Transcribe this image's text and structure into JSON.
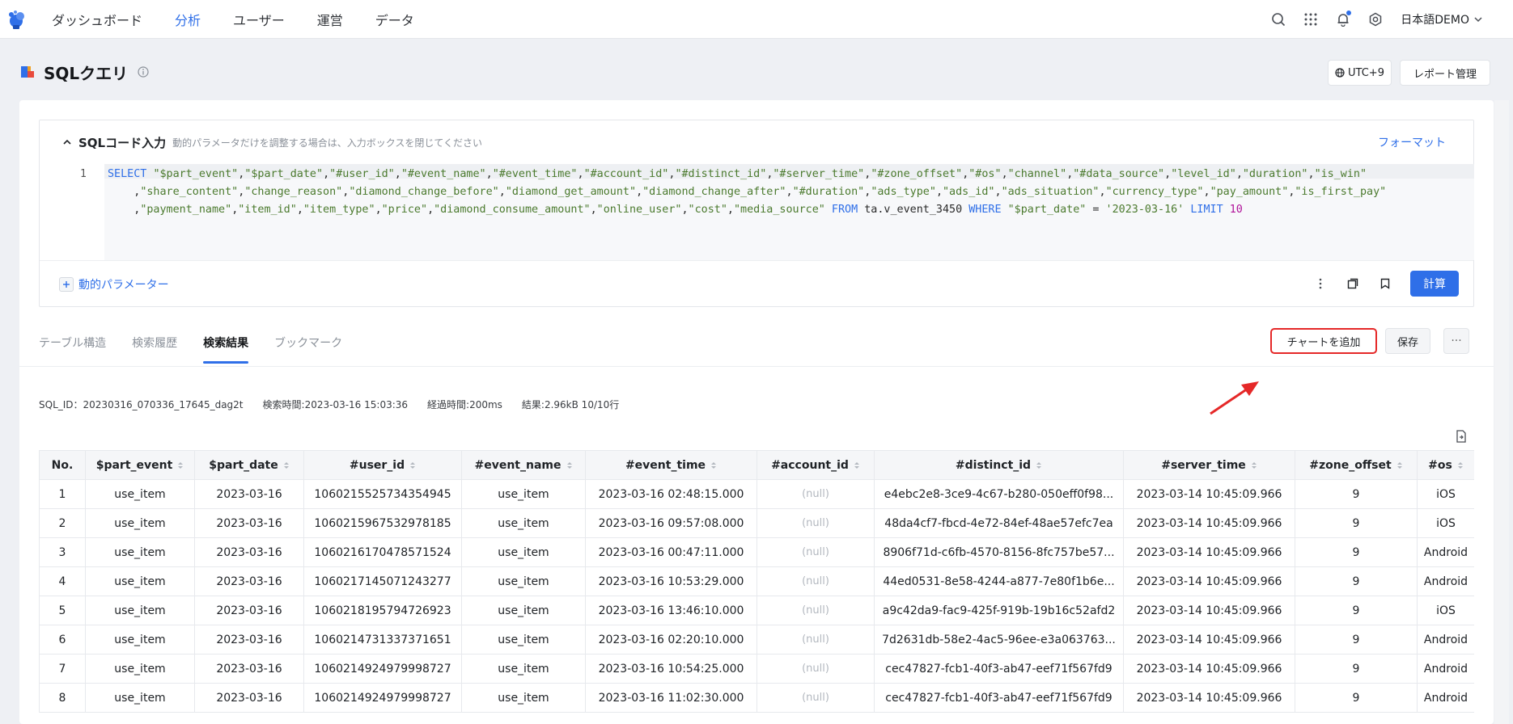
{
  "nav": {
    "items": [
      "ダッシュボード",
      "分析",
      "ユーザー",
      "運営",
      "データ"
    ],
    "active_index": 1,
    "user": "日本語DEMO",
    "icons": [
      "search-icon",
      "apps-grid-icon",
      "bell-icon",
      "gear-icon"
    ],
    "accent_color": "#2f6fe8"
  },
  "page": {
    "title": "SQLクエリ",
    "utc_label": "UTC+9",
    "report_label": "レポート管理"
  },
  "sql": {
    "title": "SQLコード入力",
    "hint": "動的パラメータだけを調整する場合は、入力ボックスを閉じてください",
    "format_label": "フォーマット",
    "line_number": "1",
    "code_lines": [
      "SELECT \"$part_event\",\"$part_date\",\"#user_id\",\"#event_name\",\"#event_time\",\"#account_id\",\"#distinct_id\",\"#server_time\",\"#zone_offset\",\"#os\",\"channel\",\"#data_source\",\"level_id\",\"duration\",\"is_win\"",
      "    ,\"share_content\",\"change_reason\",\"diamond_change_before\",\"diamond_get_amount\",\"diamond_change_after\",\"#duration\",\"ads_type\",\"ads_id\",\"ads_situation\",\"currency_type\",\"pay_amount\",\"is_first_pay\"",
      "    ,\"payment_name\",\"item_id\",\"item_type\",\"price\",\"diamond_consume_amount\",\"online_user\",\"cost\",\"media_source\" FROM ta.v_event_3450 WHERE \"$part_date\" = '2023-03-16' LIMIT 10"
    ],
    "dynamic_param_label": "動的パラメーター",
    "calc_label": "計算"
  },
  "tabs": [
    "テーブル構造",
    "検索履歴",
    "検索結果",
    "ブックマーク"
  ],
  "active_tab": 2,
  "actions": {
    "add_chart": "チャートを追加",
    "save": "保存",
    "more": "···"
  },
  "meta": {
    "sql_id": "SQL_ID：20230316_070336_17645_dag2t",
    "search_time": "検索時間:2023-03-16 15:03:36",
    "elapsed": "経過時間:200ms",
    "result": "結果:2.96kB 10/10行"
  },
  "table": {
    "columns": [
      "No.",
      "$part_event",
      "$part_date",
      "#user_id",
      "#event_name",
      "#event_time",
      "#account_id",
      "#distinct_id",
      "#server_time",
      "#zone_offset",
      "#os"
    ],
    "rows": [
      [
        "1",
        "use_item",
        "2023-03-16",
        "1060215525734354945",
        "use_item",
        "2023-03-16 02:48:15.000",
        "(null)",
        "e4ebc2e8-3ce9-4c67-b280-050eff0f98...",
        "2023-03-14 10:45:09.966",
        "9",
        "iOS"
      ],
      [
        "2",
        "use_item",
        "2023-03-16",
        "1060215967532978185",
        "use_item",
        "2023-03-16 09:57:08.000",
        "(null)",
        "48da4cf7-fbcd-4e72-84ef-48ae57efc7ea",
        "2023-03-14 10:45:09.966",
        "9",
        "iOS"
      ],
      [
        "3",
        "use_item",
        "2023-03-16",
        "1060216170478571524",
        "use_item",
        "2023-03-16 00:47:11.000",
        "(null)",
        "8906f71d-c6fb-4570-8156-8fc757be57...",
        "2023-03-14 10:45:09.966",
        "9",
        "Android"
      ],
      [
        "4",
        "use_item",
        "2023-03-16",
        "1060217145071243277",
        "use_item",
        "2023-03-16 10:53:29.000",
        "(null)",
        "44ed0531-8e58-4244-a877-7e80f1b6e...",
        "2023-03-14 10:45:09.966",
        "9",
        "Android"
      ],
      [
        "5",
        "use_item",
        "2023-03-16",
        "1060218195794726923",
        "use_item",
        "2023-03-16 13:46:10.000",
        "(null)",
        "a9c42da9-fac9-425f-919b-19b16c52afd2",
        "2023-03-14 10:45:09.966",
        "9",
        "iOS"
      ],
      [
        "6",
        "use_item",
        "2023-03-16",
        "1060214731337371651",
        "use_item",
        "2023-03-16 02:20:10.000",
        "(null)",
        "7d2631db-58e2-4ac5-96ee-e3a063763...",
        "2023-03-14 10:45:09.966",
        "9",
        "Android"
      ],
      [
        "7",
        "use_item",
        "2023-03-16",
        "1060214924979998727",
        "use_item",
        "2023-03-16 10:54:25.000",
        "(null)",
        "cec47827-fcb1-40f3-ab47-eef71f567fd9",
        "2023-03-14 10:45:09.966",
        "9",
        "Android"
      ],
      [
        "8",
        "use_item",
        "2023-03-16",
        "1060214924979998727",
        "use_item",
        "2023-03-16 11:02:30.000",
        "(null)",
        "cec47827-fcb1-40f3-ab47-eef71f567fd9",
        "2023-03-14 10:45:09.966",
        "9",
        "Android"
      ]
    ]
  }
}
